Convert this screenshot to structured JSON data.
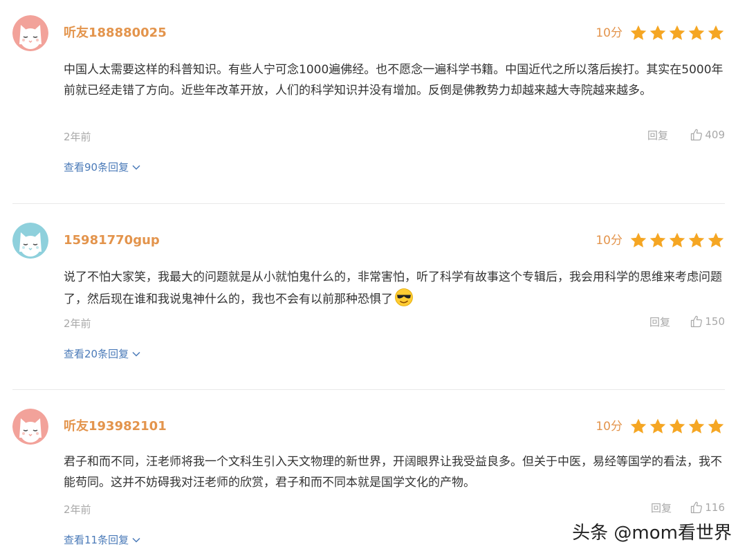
{
  "colors": {
    "username": "#e3944c",
    "star": "#f5a623",
    "link": "#4a7ab8",
    "muted": "#a8a8a8",
    "text": "#333333",
    "avatar_pink": "#f2a29a",
    "avatar_blue": "#8ed0dc"
  },
  "comments": [
    {
      "avatar": "cat-avatar-pink",
      "username": "听友188880025",
      "score": "10分",
      "stars": 5,
      "text": "中国人太需要这样的科普知识。有些人宁可念1000遍佛经。也不愿念一遍科学书籍。中国近代之所以落后挨打。其实在5000年前就已经走错了方向。近些年改革开放，人们的科学知识并没有增加。反倒是佛教势力却越来越大寺院越来越多。",
      "time": "2年前",
      "reply_label": "回复",
      "likes": "409",
      "view_replies": "查看90条回复"
    },
    {
      "avatar": "cat-avatar-blue",
      "username": "15981770gup",
      "score": "10分",
      "stars": 5,
      "text": "说了不怕大家笑，我最大的问题就是从小就怕鬼什么的，非常害怕，听了科学有故事这个专辑后，我会用科学的思维来考虑问题了，然后现在谁和我说鬼神什么的，我也不会有以前那种恐惧了",
      "emoji": "cool-face-emoji",
      "time": "2年前",
      "reply_label": "回复",
      "likes": "150",
      "view_replies": "查看20条回复"
    },
    {
      "avatar": "cat-avatar-pink",
      "username": "听友193982101",
      "score": "10分",
      "stars": 5,
      "text": "君子和而不同，汪老师将我一个文科生引入天文物理的新世界，开阔眼界让我受益良多。但关于中医，易经等国学的看法，我不能苟同。这并不妨碍我对汪老师的欣赏，君子和而不同本就是国学文化的产物。",
      "time": "2年前",
      "reply_label": "回复",
      "likes": "116",
      "view_replies": "查看11条回复"
    }
  ],
  "watermark": "头条 @mom看世界"
}
